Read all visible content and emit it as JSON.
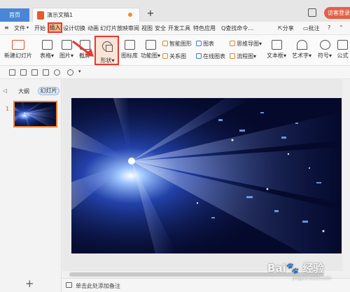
{
  "tabbar": {
    "home_label": "首页",
    "doc_title": "演示文稿1",
    "new_tab": "+",
    "login_label": "访客登录",
    "accent": "#4a86d6"
  },
  "menubar": {
    "file": "文件",
    "items_left": [
      "开始",
      "插入",
      "设计",
      "切换",
      "动画",
      "幻灯片放映",
      "审阅",
      "视图",
      "安全",
      "开发工具",
      "特色应用"
    ],
    "insert_label": "插入",
    "search": "Q查找命令…",
    "share": "分享",
    "comment": "批注",
    "help": "?"
  },
  "ribbon": {
    "new_slide": "新建幻灯片",
    "table": "表格",
    "picture": "图片",
    "screenshot": "截屏",
    "shape": "形状",
    "icon_lib": "图标库",
    "func_chart": "功能图",
    "smart_art": "智能图形",
    "chart": "图表",
    "relation": "关系图",
    "online_chart": "在线图表",
    "mind_map": "思维导图",
    "flowchart": "流程图",
    "textbox": "文本框",
    "wordart": "艺术字",
    "symbol": "符号",
    "formula": "公式"
  },
  "leftpane": {
    "outline": "大纲",
    "slides": "幻灯片",
    "slide_number": "1",
    "add": "+"
  },
  "notes": {
    "placeholder": "单击此处添加备注"
  },
  "watermark": {
    "main": "Bai🐾 经验",
    "url": "jingyan.baidu.com"
  }
}
